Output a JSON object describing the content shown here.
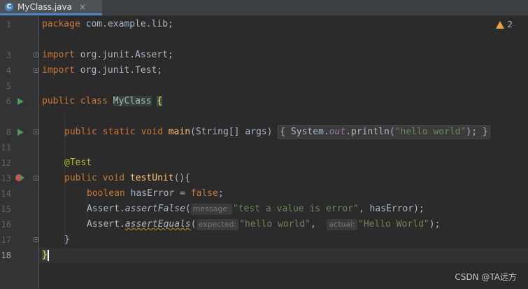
{
  "tab": {
    "filename": "MyClass.java",
    "icon": "java-class-icon",
    "close": "×"
  },
  "gutter": {
    "line_numbers": [
      "1",
      "3",
      "4",
      "5",
      "6",
      "8",
      "11",
      "12",
      "13",
      "14",
      "15",
      "16",
      "17",
      "18"
    ]
  },
  "code": {
    "l1": {
      "kw": "package",
      "rest": " com.example.lib;"
    },
    "l3": {
      "kw": "import",
      "rest": " org.junit.Assert;"
    },
    "l4": {
      "kw": "import",
      "rest": " org.junit.",
      "cls": "Test",
      "end": ";"
    },
    "l6": {
      "kw1": "public",
      "kw2": "class",
      "name": "MyClass",
      "brace": "{"
    },
    "l8": {
      "kw1": "public",
      "kw2": "static",
      "kw3": "void",
      "fn": "main",
      "params": "(String[] args) ",
      "open": "{",
      "body1": " System.",
      "out": "out",
      "body2": ".println(",
      "str": "\"hello world\"",
      "body3": "); ",
      "close": "}"
    },
    "l12": {
      "ann": "@Test"
    },
    "l13": {
      "kw1": "public",
      "kw2": "void",
      "fn": "testUnit",
      "rest": "(){"
    },
    "l14": {
      "kw": "boolean",
      "mid": " hasError = ",
      "val": "false",
      "end": ";"
    },
    "l15": {
      "cls": "Assert.",
      "fn": "assertFalse",
      "open": "(",
      "hint": "message:",
      "str": "\"test a value is error\"",
      "rest": ", hasError);"
    },
    "l16": {
      "cls": "Assert.",
      "fn": "assertEquals",
      "open": "(",
      "hint1": "expected:",
      "str1": "\"hello world\"",
      "sep": ", ",
      "hint2": "actual:",
      "str2": "\"Hello World\"",
      "rest": ");"
    },
    "l17": {
      "text": "}"
    },
    "l18": {
      "text": "}"
    }
  },
  "warnings": {
    "count": "2",
    "icon": "warning-icon"
  },
  "watermark": "CSDN @TA远方",
  "colors": {
    "background": "#2b2b2b",
    "keyword": "#cc7832",
    "string": "#6a8759",
    "annotation": "#bbb529",
    "function": "#ffc66d"
  }
}
